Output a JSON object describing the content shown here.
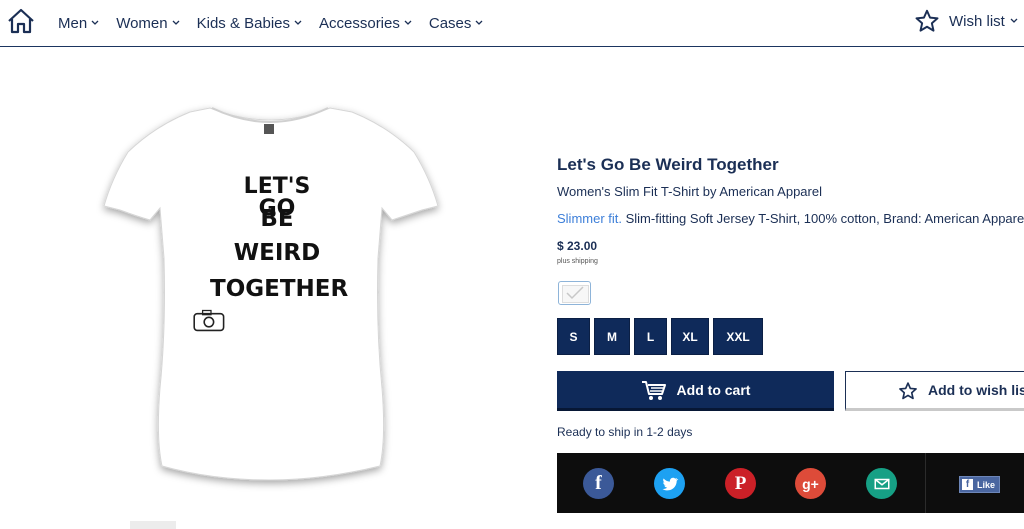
{
  "header": {
    "nav": [
      {
        "label": "Men"
      },
      {
        "label": "Women"
      },
      {
        "label": "Kids & Babies"
      },
      {
        "label": "Accessories"
      },
      {
        "label": "Cases"
      }
    ],
    "wishlist_label": "Wish list"
  },
  "product": {
    "print_lines": [
      "LET'S GO",
      "BE",
      "WEIRD",
      "TOGETHER"
    ],
    "title": "Let's Go Be Weird Together",
    "subtitle": "Women's Slim Fit T-Shirt by American Apparel",
    "fit_link": "Slimmer fit.",
    "fit_desc": " Slim-fitting Soft Jersey T-Shirt, 100% cotton, Brand: American Apparel",
    "price": "$ 23.00",
    "shipping_note": "plus shipping",
    "sizes": [
      "S",
      "M",
      "L",
      "XL",
      "XXL"
    ],
    "add_to_cart": "Add to cart",
    "add_to_wishlist": "Add to wish list",
    "ship_note": "Ready to ship in 1-2 days",
    "like_label": "Like"
  },
  "colors": {
    "navy": "#0f2a5a",
    "facebook": "#3b5998",
    "twitter": "#1da1f2",
    "pinterest": "#cb2027",
    "googleplus": "#dd4b39",
    "email": "#16a085"
  },
  "icons": [
    "home-icon",
    "chevron-down-icon",
    "star-icon",
    "cart-icon",
    "facebook-icon",
    "twitter-icon",
    "pinterest-icon",
    "googleplus-icon",
    "email-icon"
  ]
}
